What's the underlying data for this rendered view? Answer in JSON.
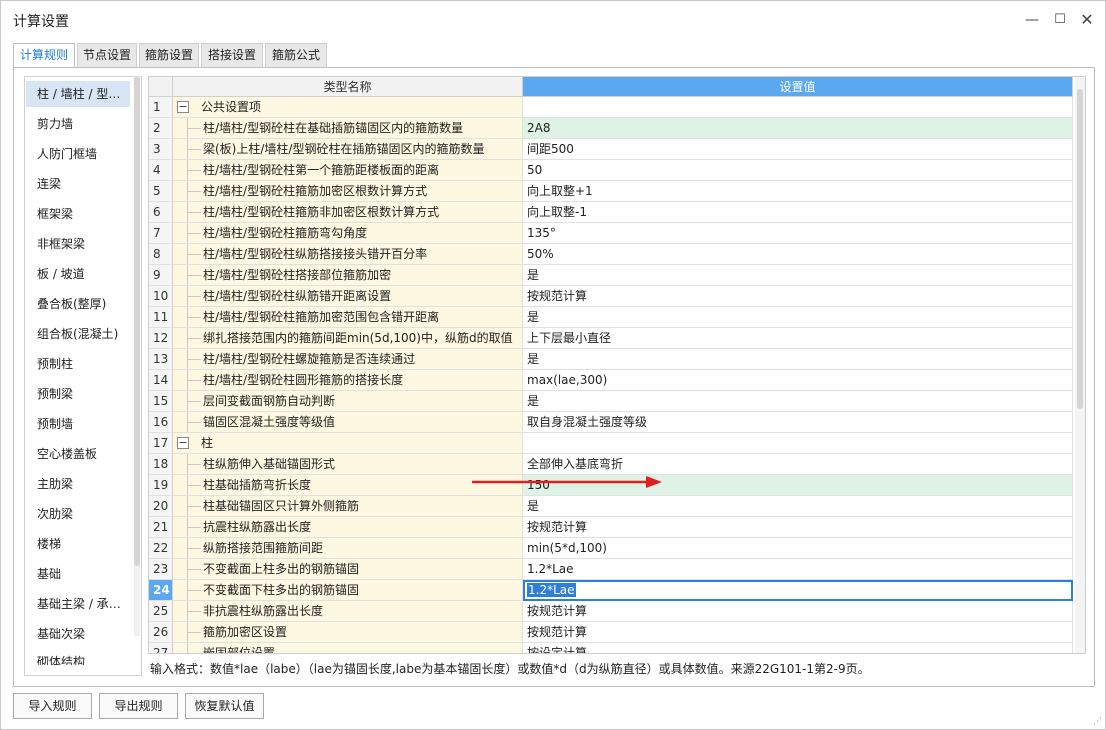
{
  "window": {
    "title": "计算设置"
  },
  "tabs": [
    {
      "label": "计算规则",
      "active": true
    },
    {
      "label": "节点设置",
      "active": false
    },
    {
      "label": "箍筋设置",
      "active": false
    },
    {
      "label": "搭接设置",
      "active": false
    },
    {
      "label": "箍筋公式",
      "active": false
    }
  ],
  "sidebar": {
    "items": [
      "柱 / 墙柱 / 型钢柱",
      "剪力墙",
      "人防门框墙",
      "连梁",
      "框架梁",
      "非框架梁",
      "板 / 坡道",
      "叠合板(整厚)",
      "组合板(混凝土)",
      "预制柱",
      "预制梁",
      "预制墙",
      "空心楼盖板",
      "主肋梁",
      "次肋梁",
      "楼梯",
      "基础",
      "基础主梁 / 承台梁",
      "基础次梁",
      "砌体结构"
    ],
    "active_index": 0
  },
  "grid": {
    "header": {
      "name": "类型名称",
      "value": "设置值"
    },
    "rows": [
      {
        "num": "1",
        "name": "公共设置项",
        "value": "",
        "group": true
      },
      {
        "num": "2",
        "name": "柱/墙柱/型钢砼柱在基础插筋锚固区内的箍筋数量",
        "value": "2A8",
        "highlight": true
      },
      {
        "num": "3",
        "name": "梁(板)上柱/墙柱/型钢砼柱在插筋锚固区内的箍筋数量",
        "value": "间距500"
      },
      {
        "num": "4",
        "name": "柱/墙柱/型钢砼柱第一个箍筋距楼板面的距离",
        "value": "50"
      },
      {
        "num": "5",
        "name": "柱/墙柱/型钢砼柱箍筋加密区根数计算方式",
        "value": "向上取整+1"
      },
      {
        "num": "6",
        "name": "柱/墙柱/型钢砼柱箍筋非加密区根数计算方式",
        "value": "向上取整-1"
      },
      {
        "num": "7",
        "name": "柱/墙柱/型钢砼柱箍筋弯勾角度",
        "value": "135°"
      },
      {
        "num": "8",
        "name": "柱/墙柱/型钢砼柱纵筋搭接接头错开百分率",
        "value": "50%"
      },
      {
        "num": "9",
        "name": "柱/墙柱/型钢砼柱搭接部位箍筋加密",
        "value": "是"
      },
      {
        "num": "10",
        "name": "柱/墙柱/型钢砼柱纵筋错开距离设置",
        "value": "按规范计算"
      },
      {
        "num": "11",
        "name": "柱/墙柱/型钢砼柱箍筋加密范围包含错开距离",
        "value": "是"
      },
      {
        "num": "12",
        "name": "绑扎搭接范围内的箍筋间距min(5d,100)中，纵筋d的取值",
        "value": "上下层最小直径"
      },
      {
        "num": "13",
        "name": "柱/墙柱/型钢砼柱螺旋箍筋是否连续通过",
        "value": "是"
      },
      {
        "num": "14",
        "name": "柱/墙柱/型钢砼柱圆形箍筋的搭接长度",
        "value": "max(lae,300)"
      },
      {
        "num": "15",
        "name": "层间变截面钢筋自动判断",
        "value": "是"
      },
      {
        "num": "16",
        "name": "锚固区混凝土强度等级值",
        "value": "取自身混凝土强度等级"
      },
      {
        "num": "17",
        "name": "柱",
        "value": "",
        "group": true
      },
      {
        "num": "18",
        "name": "柱纵筋伸入基础锚固形式",
        "value": "全部伸入基底弯折"
      },
      {
        "num": "19",
        "name": "柱基础插筋弯折长度",
        "value": "150",
        "highlight": true
      },
      {
        "num": "20",
        "name": "柱基础锚固区只计算外侧箍筋",
        "value": "是"
      },
      {
        "num": "21",
        "name": "抗震柱纵筋露出长度",
        "value": "按规范计算"
      },
      {
        "num": "22",
        "name": "纵筋搭接范围箍筋间距",
        "value": "min(5*d,100)"
      },
      {
        "num": "23",
        "name": "不变截面上柱多出的钢筋锚固",
        "value": "1.2*Lae"
      },
      {
        "num": "24",
        "name": "不变截面下柱多出的钢筋锚固",
        "value": "1.2*Lae",
        "current": true
      },
      {
        "num": "25",
        "name": "非抗震柱纵筋露出长度",
        "value": "按规范计算"
      },
      {
        "num": "26",
        "name": "箍筋加密区设置",
        "value": "按规范计算"
      },
      {
        "num": "27",
        "name": "嵌固部位设置",
        "value": "按设定计算"
      }
    ]
  },
  "hint": "输入格式：数值*lae（labe）（lae为锚固长度,labe为基本锚固长度）或数值*d（d为纵筋直径）或具体数值。来源22G101-1第2-9页。",
  "buttons": {
    "import": "导入规则",
    "export": "导出规则",
    "restore": "恢复默认值"
  },
  "colors": {
    "accent": "#5aa8f0",
    "highlight_row": "#dff2e6",
    "name_cell": "#fdf8e1",
    "arrow": "#e02020"
  }
}
